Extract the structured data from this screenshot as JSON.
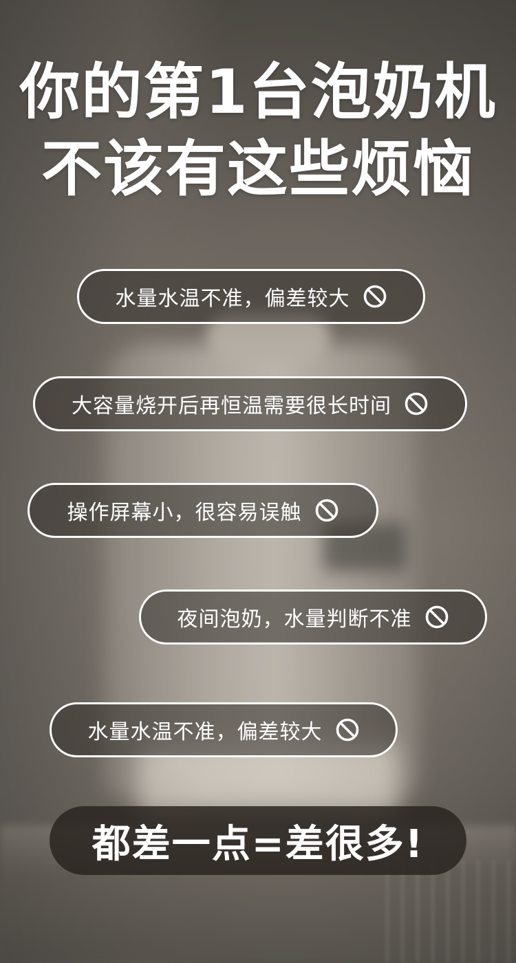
{
  "headline": {
    "line1": "你的第1台泡奶机",
    "line2": "不该有这些烦恼"
  },
  "pain_points": [
    {
      "text": "水量水温不准，偏差较大",
      "icon": "ban-icon"
    },
    {
      "text": "大容量烧开后再恒温需要很长时间",
      "icon": "ban-icon"
    },
    {
      "text": "操作屏幕小，很容易误触",
      "icon": "ban-icon"
    },
    {
      "text": "夜间泡奶，水量判断不准",
      "icon": "ban-icon"
    },
    {
      "text": "水量水温不准，偏差较大",
      "icon": "ban-icon"
    }
  ],
  "conclusion": "都差一点=差很多!",
  "colors": {
    "text": "#ffffff",
    "pill_border": "#ffffff",
    "conclusion_bg": "#28221e"
  }
}
